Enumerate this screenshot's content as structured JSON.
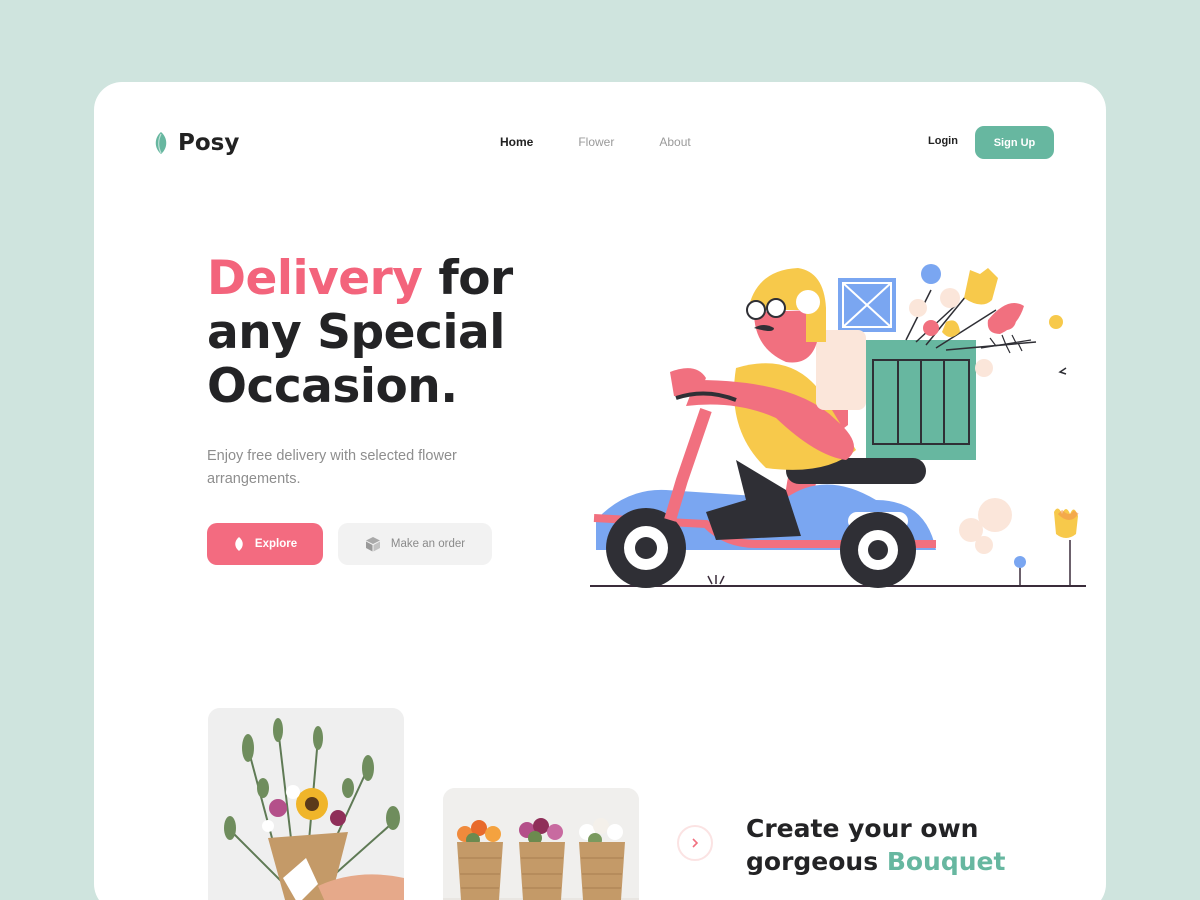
{
  "brand": {
    "name": "Posy",
    "accent": "#67b7a0",
    "highlight": "#f3647c"
  },
  "nav": {
    "items": [
      {
        "label": "Home",
        "active": true
      },
      {
        "label": "Flower",
        "active": false
      },
      {
        "label": "About",
        "active": false
      }
    ]
  },
  "auth": {
    "login_label": "Login",
    "signup_label": "Sign Up"
  },
  "hero": {
    "title_highlight": "Delivery",
    "title_rest_1": " for",
    "title_line_2": "any Special",
    "title_line_3": "Occasion.",
    "subtitle": "Enjoy free delivery with selected flower arrangements.",
    "explore_label": "Explore",
    "explore_icon": "leaf-icon",
    "order_label": "Make an order",
    "order_icon": "box-icon"
  },
  "bouquet": {
    "title_line_1": "Create your own",
    "title_line_2_prefix": "gorgeous ",
    "title_line_2_highlight": "Bouquet",
    "arrow_icon": "chevron-right-icon"
  }
}
